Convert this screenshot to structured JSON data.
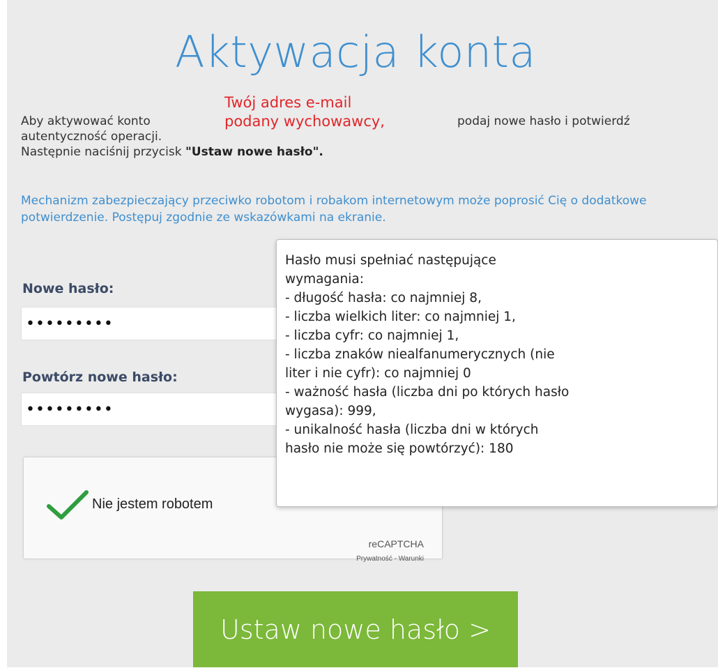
{
  "title": "Aktywacja konta",
  "annotation": {
    "line1": "Twój adres e-mail",
    "line2": "podany wychowawcy,"
  },
  "intro": {
    "line1a": "Aby aktywować konto",
    "line1b": "podaj nowe hasło i potwierdź",
    "line2": "autentyczność operacji.",
    "line3_prefix": "Następnie naciśnij przycisk ",
    "line3_bold": "\"Ustaw nowe hasło\"."
  },
  "notice": "Mechanizm zabezpieczający przeciwko robotom i robakom internetowym może poprosić Cię o dodatkowe potwierdzenie. Postępuj zgodnie ze wskazówkami na ekranie.",
  "form": {
    "new_password_label": "Nowe hasło:",
    "new_password_value": "•••••••••",
    "repeat_password_label": "Powtórz nowe hasło:",
    "repeat_password_value": "•••••••••"
  },
  "captcha": {
    "label": "Nie jestem robotem",
    "brand": "reCAPTCHA",
    "links": "Prywatność - Warunki"
  },
  "tooltip": {
    "text": "Hasło musi spełniać następujące\nwymagania:\n- długość hasła: co najmniej 8,\n- liczba wielkich liter: co najmniej 1,\n- liczba cyfr: co najmniej 1,\n- liczba znaków niealfanumerycznych (nie\nliter i nie cyfr): co najmniej 0\n- ważność hasła (liczba dni po których hasło\nwygasa): 999,\n- unikalność hasła (liczba dni w których\nhasło nie może się powtórzyć): 180"
  },
  "submit_label": "Ustaw nowe hasło >",
  "colors": {
    "accent_blue": "#3f8fcf",
    "annotation_red": "#e0262a",
    "button_green": "#7cb83a",
    "check_green": "#2e9e3e"
  }
}
